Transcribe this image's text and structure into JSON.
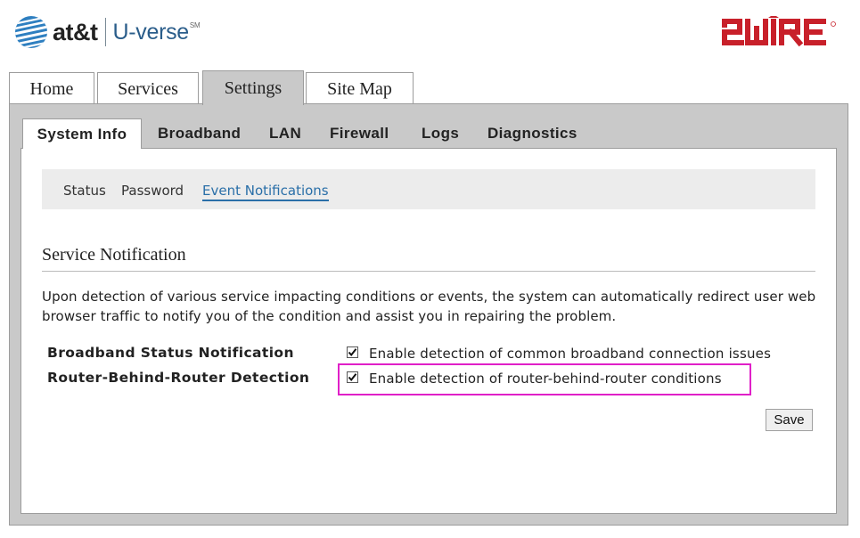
{
  "header": {
    "att_label": "at&t",
    "uverse_label": "U-verse",
    "uverse_mark": "SM",
    "brand_2wire": "2WIRE",
    "brand_color_att": "#2a5d8a",
    "brand_color_2wire": "#c8202a"
  },
  "top_tabs": [
    {
      "label": "Home"
    },
    {
      "label": "Services"
    },
    {
      "label": "Settings",
      "active": true
    },
    {
      "label": "Site Map"
    }
  ],
  "sub_tabs": [
    {
      "label": "System Info",
      "active": true
    },
    {
      "label": "Broadband"
    },
    {
      "label": "LAN"
    },
    {
      "label": "Firewall"
    },
    {
      "label": "Logs"
    },
    {
      "label": "Diagnostics"
    }
  ],
  "sub_nav": [
    {
      "label": "Status"
    },
    {
      "label": "Password"
    },
    {
      "label": "Event Notifications",
      "active": true
    }
  ],
  "section": {
    "title": "Service Notification",
    "description": "Upon detection of various service impacting conditions or events, the system can automatically redirect user web browser traffic to notify you of the condition and assist you in repairing the problem."
  },
  "settings": [
    {
      "label": "Broadband Status Notification",
      "checkbox_text": "Enable detection of common broadband connection issues",
      "checked": true
    },
    {
      "label": "Router-Behind-Router Detection",
      "checkbox_text": "Enable detection of router-behind-router conditions",
      "checked": true
    }
  ],
  "actions": {
    "save_label": "Save"
  },
  "colors": {
    "accent_link": "#2a6fa8",
    "highlight": "#e020c8"
  }
}
